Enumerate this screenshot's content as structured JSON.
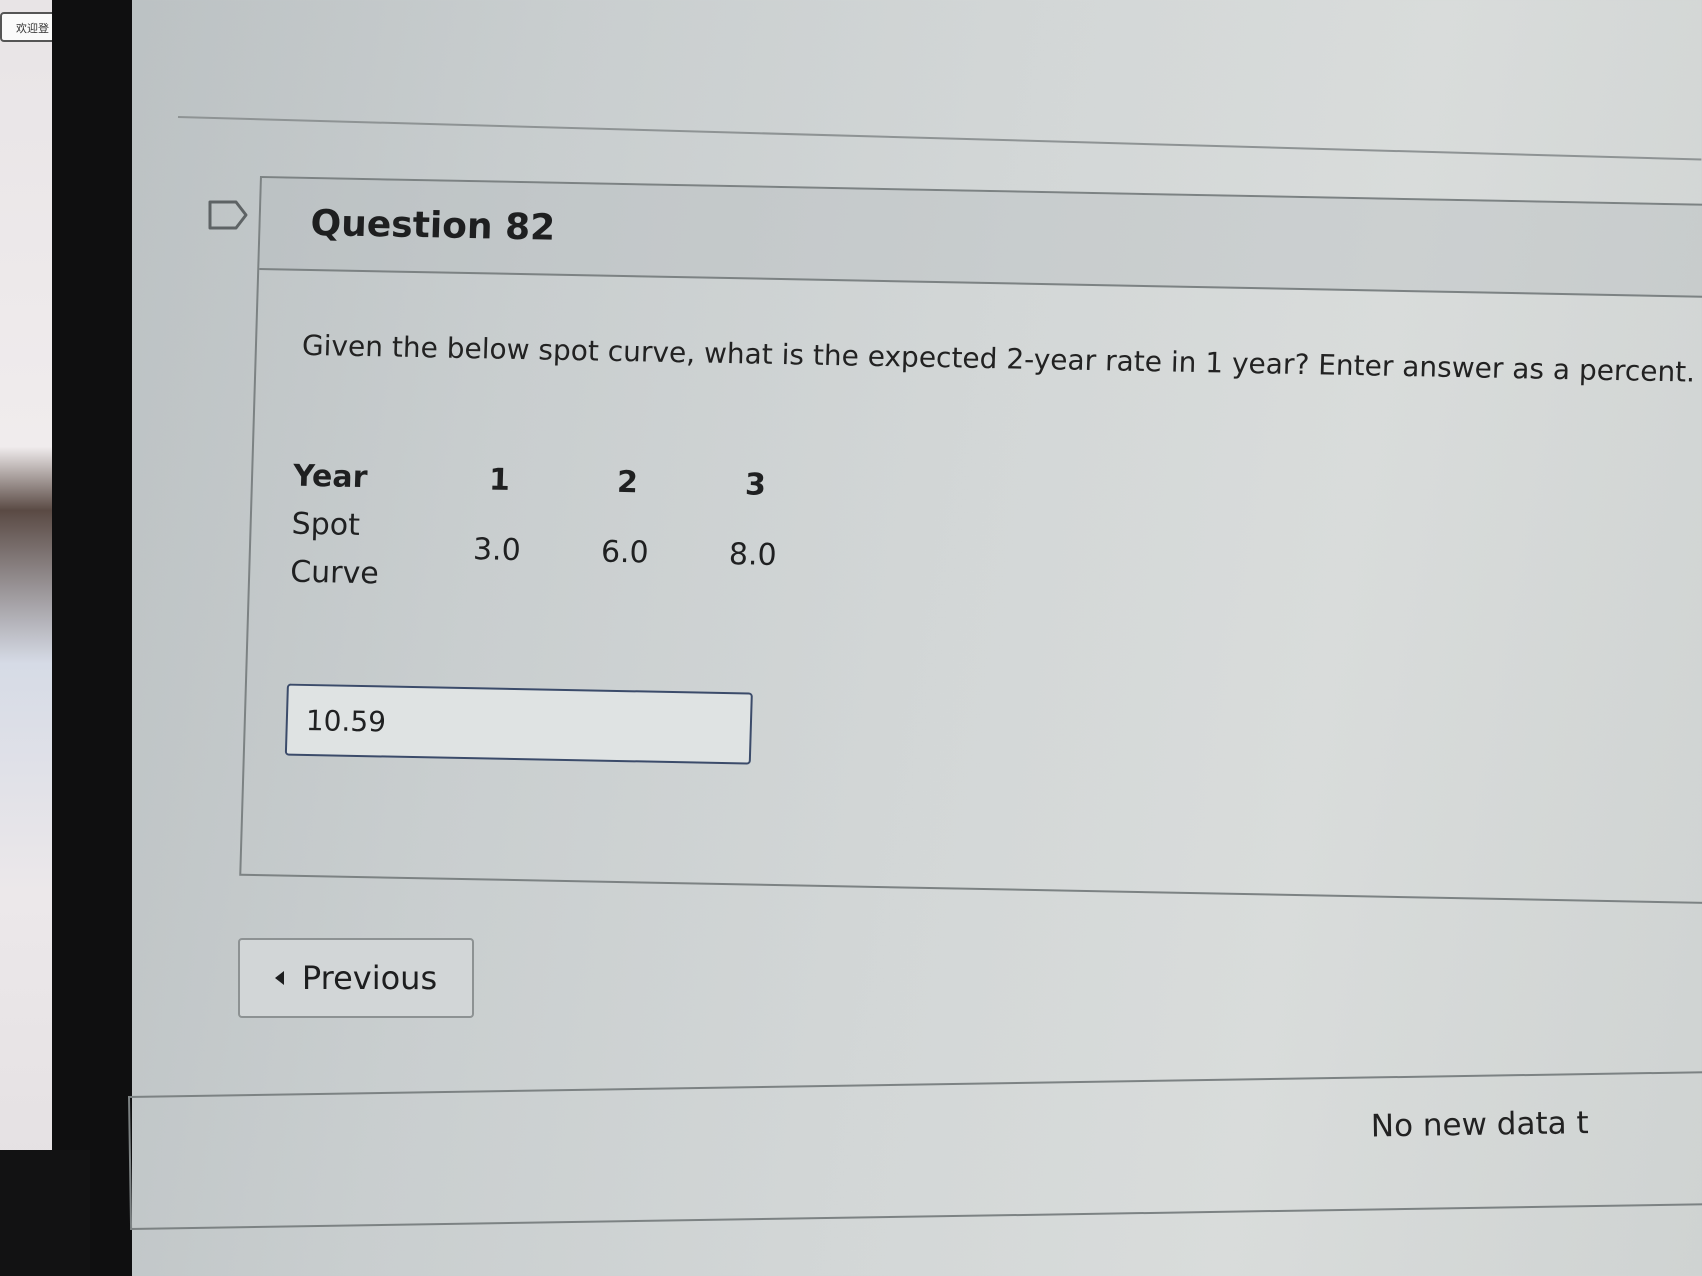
{
  "question": {
    "title": "Question 82",
    "prompt": "Given the below spot curve, what is the expected 2-year rate in 1 year?  Enter answer as a percent.",
    "table": {
      "row_header_year": "Year",
      "row_header_spot": "Spot",
      "row_header_curve": "Curve",
      "years": [
        "1",
        "2",
        "3"
      ],
      "spot_rates": [
        "3.0",
        "6.0",
        "8.0"
      ]
    },
    "answer_value": "10.59"
  },
  "navigation": {
    "previous_label": "Previous"
  },
  "footer": {
    "status_text": "No new data t"
  },
  "sticker_text": "欢迎登",
  "icons": {
    "bookmark": "bookmark-flag-icon",
    "previous": "caret-left-icon"
  }
}
